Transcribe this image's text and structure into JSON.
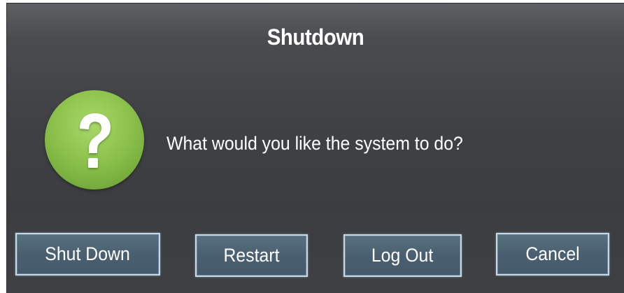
{
  "dialog": {
    "title": "Shutdown",
    "message": "What would you like the system to do?",
    "icon": "question-mark-icon",
    "icon_color": "#8cc24c"
  },
  "buttons": {
    "shut_down": "Shut Down",
    "restart": "Restart",
    "log_out": "Log Out",
    "cancel": "Cancel"
  },
  "colors": {
    "dialog_background": "#3f4144",
    "button_background": "#4a6070",
    "button_border": "#c6d8e6",
    "text": "#ffffff"
  }
}
